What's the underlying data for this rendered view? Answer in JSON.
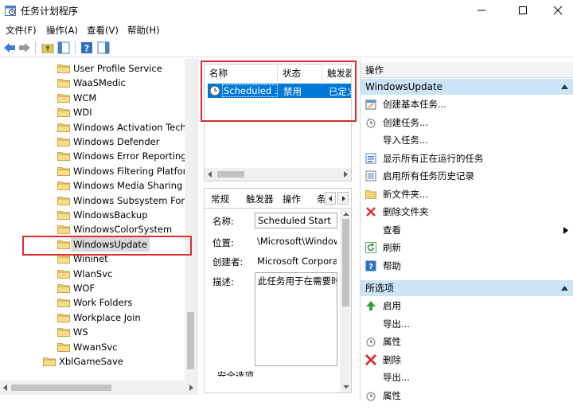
{
  "window": {
    "title": "任务计划程序"
  },
  "menu": [
    "文件(F)",
    "操作(A)",
    "查看(V)",
    "帮助(H)"
  ],
  "tree": {
    "items": [
      "User Profile Service",
      "WaaSMedic",
      "WCM",
      "WDI",
      "Windows Activation Techn",
      "Windows Defender",
      "Windows Error Reporting",
      "Windows Filtering Platforr",
      "Windows Media Sharing",
      "Windows Subsystem For L",
      "WindowsBackup",
      "WindowsColorSystem",
      "WindowsUpdate",
      "Wininet",
      "WlanSvc",
      "WOF",
      "Work Folders",
      "Workplace Join",
      "WS",
      "WwanSvc"
    ],
    "root_item": "XblGameSave",
    "selected": "WindowsUpdate"
  },
  "tasklist": {
    "columns": [
      "名称",
      "状态",
      "触发器"
    ],
    "row": {
      "name": "Scheduled ...",
      "status": "禁用",
      "trigger": "已定义"
    }
  },
  "props": {
    "tabs": [
      "常规",
      "触发器",
      "操作",
      "条"
    ],
    "name_label": "名称:",
    "name_value": "Scheduled Start",
    "location_label": "位置:",
    "location_value": "\\Microsoft\\Windows",
    "author_label": "创建者:",
    "author_value": "Microsoft Corpora",
    "desc_label": "描述:",
    "desc_value": "此任务用于在需要时",
    "security_label": "安全选项"
  },
  "actions": {
    "title": "操作",
    "section1": "WindowsUpdate",
    "items1": [
      "创建基本任务...",
      "创建任务...",
      "导入任务...",
      "显示所有正在运行的任务",
      "启用所有任务历史记录",
      "新文件夹...",
      "删除文件夹",
      "查看",
      "刷新",
      "帮助"
    ],
    "section2": "所选项",
    "items2": [
      "启用",
      "导出...",
      "属性",
      "删除",
      "导出...",
      "属性"
    ]
  },
  "colors": {
    "selection": "#0078d7",
    "section": "#cce4f7",
    "highlight_box": "#d9302c"
  }
}
